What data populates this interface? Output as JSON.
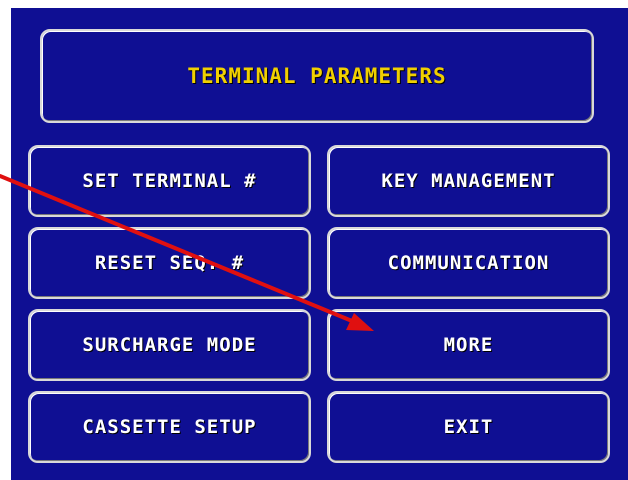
{
  "screen": {
    "title": "TERMINAL PARAMETERS"
  },
  "buttons": {
    "set_terminal": "SET TERMINAL #",
    "key_management": "KEY MANAGEMENT",
    "reset_seq": "RESET SEQ. #",
    "communication": "COMMUNICATION",
    "surcharge_mode": "SURCHARGE MODE",
    "more": "MORE",
    "cassette_setup": "CASSETTE SETUP",
    "exit": "EXIT"
  },
  "colors": {
    "screen_background": "#0f0f93",
    "title_text": "#f0d000",
    "button_text": "#ffffff",
    "button_border": "#d9d9d9",
    "annotation_arrow": "#e01010"
  },
  "annotation": {
    "icon": "red-arrow-icon",
    "points_to": "MORE"
  }
}
